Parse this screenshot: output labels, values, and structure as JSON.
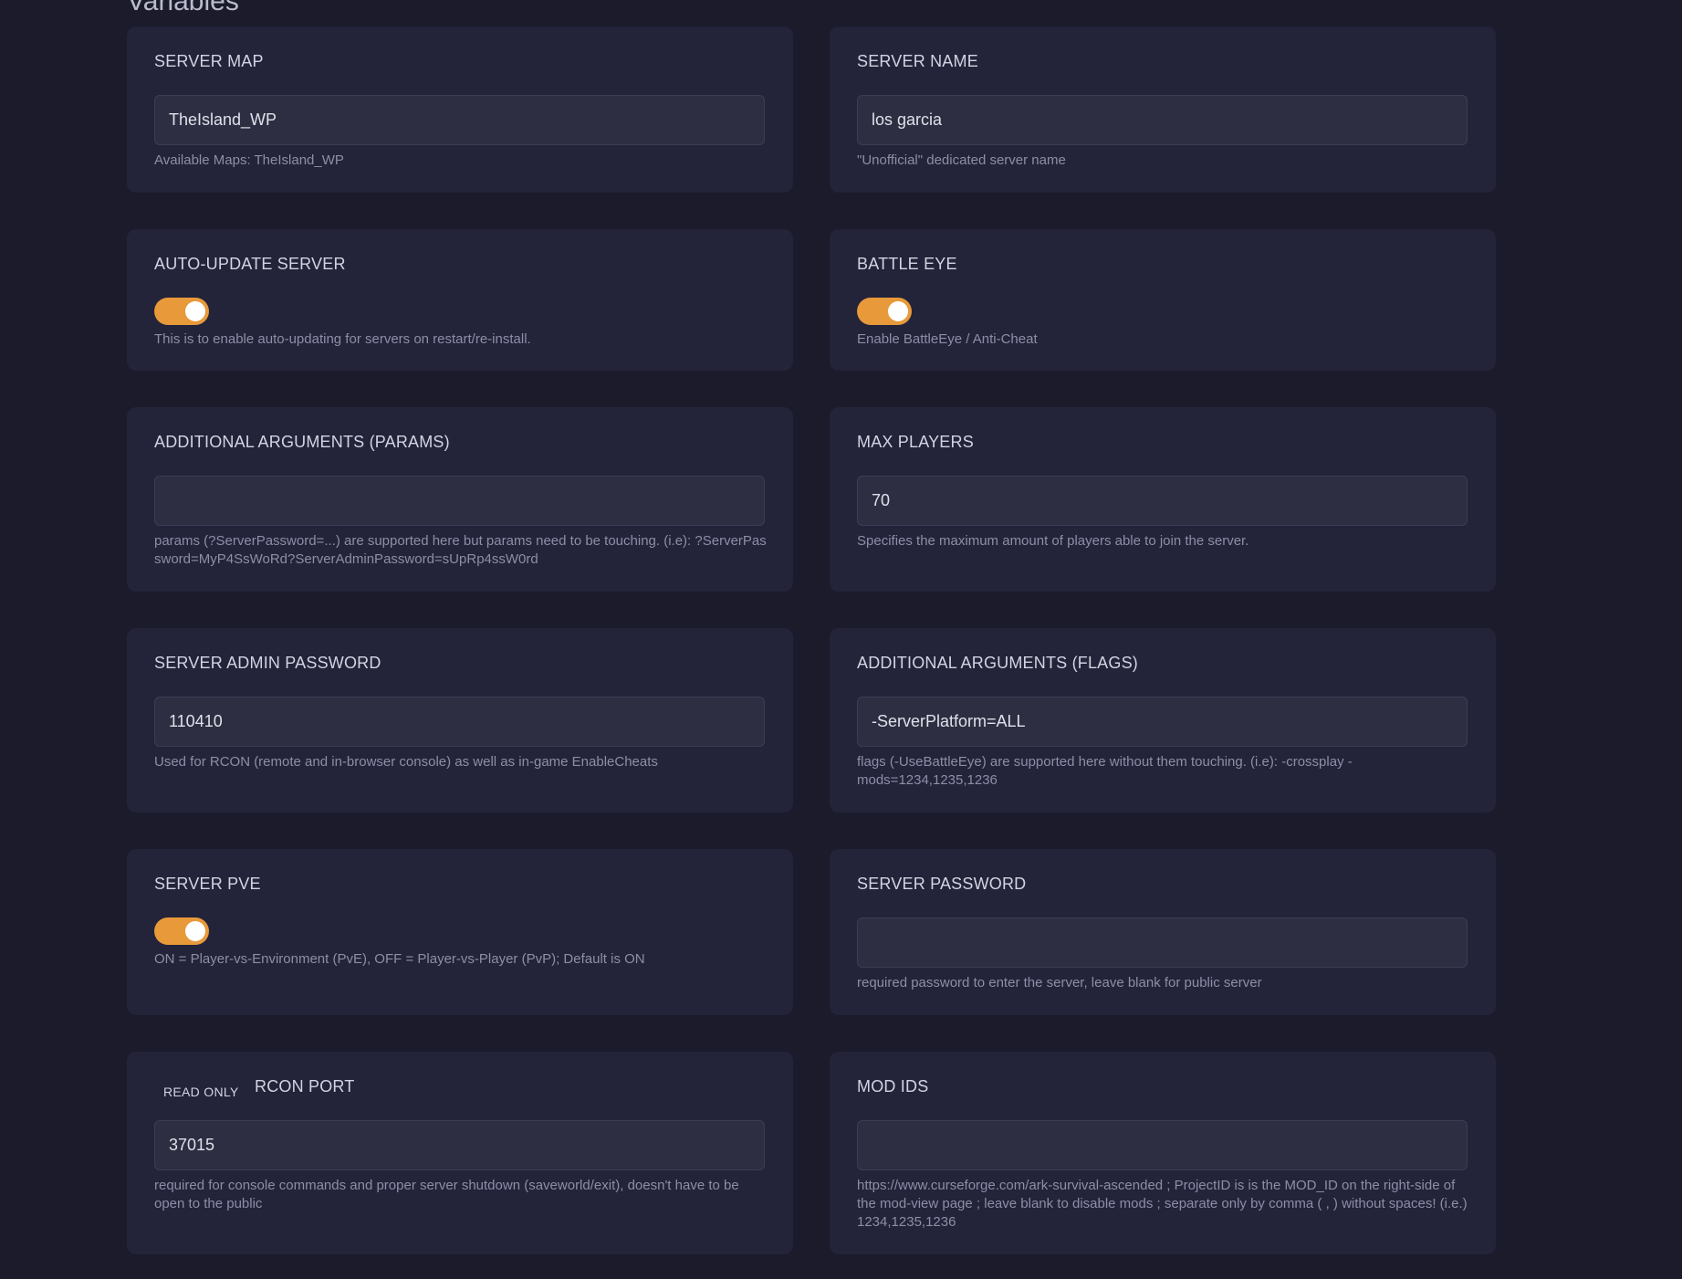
{
  "page": {
    "heading": "Variables"
  },
  "colors": {
    "background": "#1b1b2b",
    "card": "#23233a",
    "input": "#2e2e42",
    "toggle_on": "#e8993a"
  },
  "fields": {
    "server_map": {
      "label": "SERVER MAP",
      "value": "TheIsland_WP",
      "help": "Available Maps: TheIsland_WP"
    },
    "server_name": {
      "label": "SERVER NAME",
      "value": "los garcia",
      "help": "\"Unofficial\" dedicated server name"
    },
    "auto_update": {
      "label": "AUTO-UPDATE SERVER",
      "enabled": true,
      "help": "This is to enable auto-updating for servers on restart/re-install."
    },
    "battle_eye": {
      "label": "BATTLE EYE",
      "enabled": true,
      "help": "Enable BattleEye / Anti-Cheat"
    },
    "additional_params": {
      "label": "ADDITIONAL ARGUMENTS (PARAMS)",
      "value": "",
      "help": "params (?ServerPassword=...) are supported here but params need to be touching. (i.e): ?ServerPassword=MyP4SsWoRd?ServerAdminPassword=sUpRp4ssW0rd"
    },
    "max_players": {
      "label": "MAX PLAYERS",
      "value": "70",
      "help": "Specifies the maximum amount of players able to join the server."
    },
    "admin_password": {
      "label": "SERVER ADMIN PASSWORD",
      "value": "110410",
      "help": "Used for RCON (remote and in-browser console) as well as in-game EnableCheats"
    },
    "additional_flags": {
      "label": "ADDITIONAL ARGUMENTS (FLAGS)",
      "value": "-ServerPlatform=ALL",
      "help": "flags (-UseBattleEye) are supported here without them touching. (i.e): -crossplay -mods=1234,1235,1236"
    },
    "server_pve": {
      "label": "SERVER PVE",
      "enabled": true,
      "help": "ON = Player-vs-Environment (PvE), OFF = Player-vs-Player (PvP); Default is ON"
    },
    "server_password": {
      "label": "SERVER PASSWORD",
      "value": "",
      "help": "required password to enter the server, leave blank for public server"
    },
    "rcon_port": {
      "badge": "READ ONLY",
      "label": "RCON PORT",
      "value": "37015",
      "help": "required for console commands and proper server shutdown (saveworld/exit), doesn't have to be open to the public"
    },
    "mod_ids": {
      "label": "MOD IDS",
      "value": "",
      "help": "https://www.curseforge.com/ark-survival-ascended ; ProjectID is is the MOD_ID on the right-side of the mod-view page ; leave blank to disable mods ; separate only by comma ( , ) without spaces! (i.e.) 1234,1235,1236"
    }
  }
}
